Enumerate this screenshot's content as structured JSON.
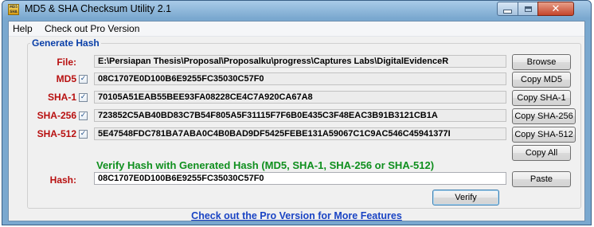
{
  "window": {
    "title": "MD5 & SHA Checksum Utility 2.1",
    "icon_text": "MD5 SHA",
    "controls": {
      "minimize": "minimize",
      "maximize": "maximize",
      "close": "✕"
    }
  },
  "menu": [
    "Help",
    "Check out Pro Version"
  ],
  "group_title": "Generate Hash",
  "rows": {
    "file": {
      "label": "File:",
      "value": "E:\\Persiapan Thesis\\Proposal\\Proposalku\\progress\\Captures Labs\\DigitalEvidenceR",
      "button": "Browse"
    },
    "md5": {
      "label": "MD5",
      "checked": true,
      "value": "08C1707E0D100B6E9255FC35030C57F0",
      "button": "Copy MD5"
    },
    "sha1": {
      "label": "SHA-1",
      "checked": true,
      "value": "70105A51EAB55BEE93FA08228CE4C7A920CA67A8",
      "button": "Copy SHA-1"
    },
    "sha256": {
      "label": "SHA-256",
      "checked": true,
      "value": "723852C5AB40BD83C7B54F805A5F31115F7F6B0E435C3F48EAC3B91B3121CB1A",
      "button": "Copy SHA-256"
    },
    "sha512": {
      "label": "SHA-512",
      "checked": true,
      "value": "5E47548FDC781BA7ABA0C4B0BAD9DF5425FEBE131A59067C1C9AC546C45941377I",
      "button": "Copy SHA-512"
    }
  },
  "copy_all_button": "Copy All",
  "verify_heading": "Verify Hash with Generated Hash (MD5, SHA-1, SHA-256 or SHA-512)",
  "hash": {
    "label": "Hash:",
    "value": "08C1707E0D100B6E9255FC35030C57F0",
    "paste_button": "Paste"
  },
  "verify_button": "Verify",
  "promo_link": "Check out the Pro Version for More Features",
  "colors": {
    "label_red": "#b81010",
    "heading_green": "#0f8f1e",
    "group_blue": "#0a3fa8",
    "link_blue": "#1a44c4"
  }
}
